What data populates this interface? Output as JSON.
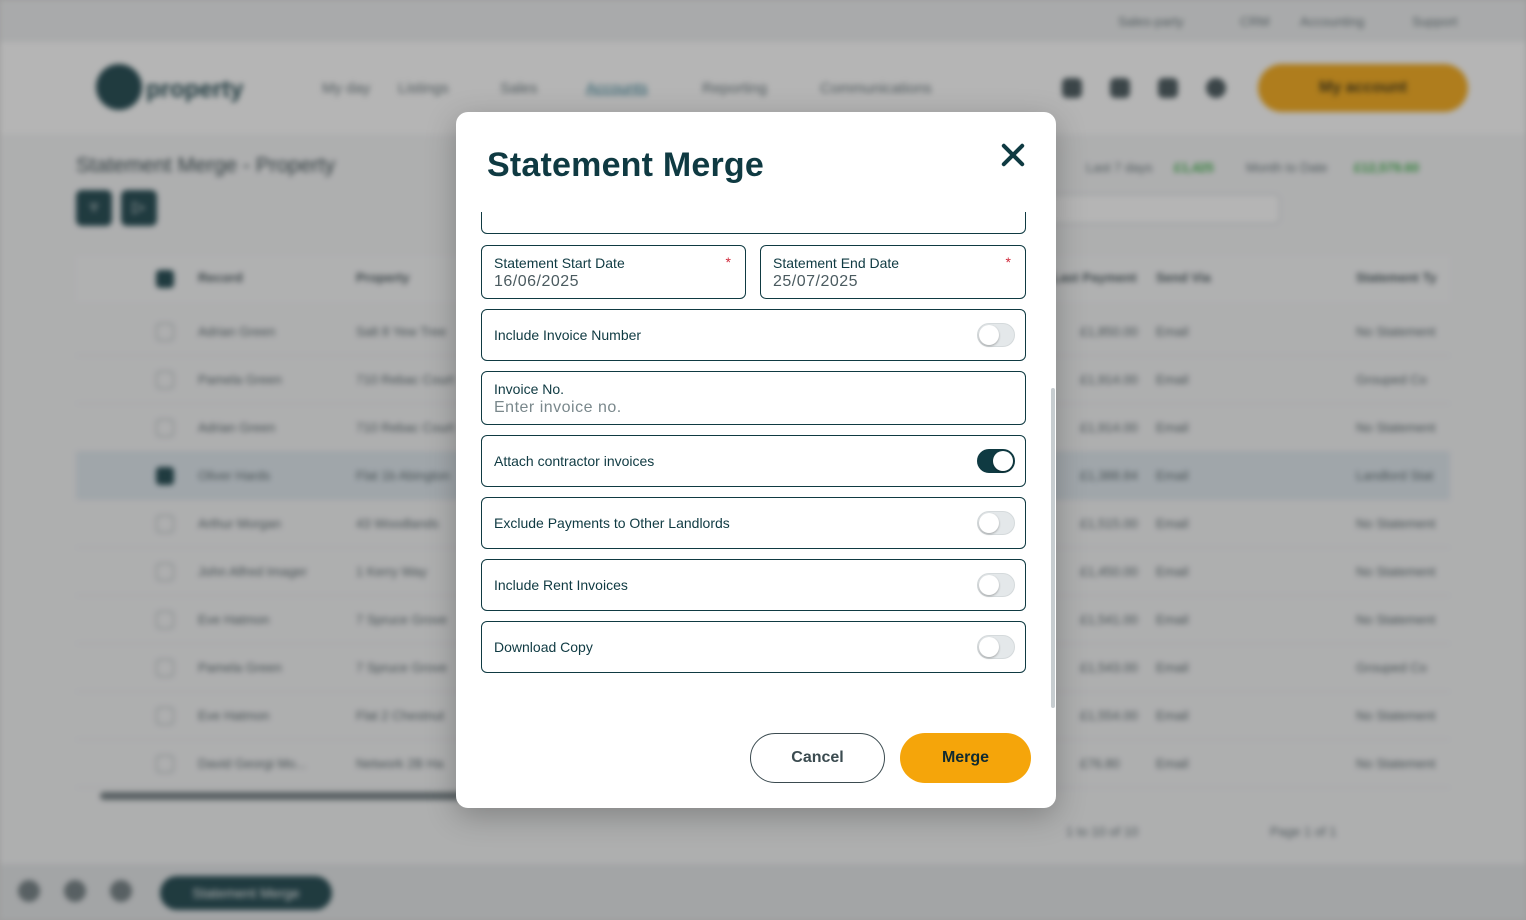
{
  "background": {
    "top_links": [
      "Sales-party",
      "CRM",
      "Accounting",
      "Support"
    ],
    "logo_text": "property",
    "nav_items": [
      "My day",
      "Listings",
      "Sales",
      "Accounts",
      "Reporting",
      "Communications"
    ],
    "active_nav": "Accounts",
    "my_account_label": "My account",
    "page_title": "Statement Merge - Property",
    "stats": [
      {
        "label": "Last 7 days",
        "value": "£1,425"
      },
      {
        "label": "Month to Date",
        "value": "£12,579.60"
      }
    ],
    "table": {
      "headers": [
        "Record",
        "Property",
        "Last Payment",
        "Send Via",
        "Statement Ty"
      ],
      "rows": [
        {
          "record": "Adrian Green",
          "property": "Salt 8 Yew Tree",
          "payment": "£1,850.00",
          "via": "Email",
          "type": "No Statement",
          "checked": false
        },
        {
          "record": "Pamela Green",
          "property": "710 Rebac Court",
          "payment": "£1,914.00",
          "via": "Email",
          "type": "Grouped Co",
          "checked": false
        },
        {
          "record": "Adrian Green",
          "property": "710 Rebac Court",
          "payment": "£1,914.00",
          "via": "Email",
          "type": "No Statement",
          "checked": false
        },
        {
          "record": "Oliver Hards",
          "property": "Flat 1b Abington",
          "payment": "£1,388.84",
          "via": "Email",
          "type": "Landlord Stat",
          "checked": true
        },
        {
          "record": "Arthur Morgan",
          "property": "43 Woodlands",
          "payment": "£1,515.00",
          "via": "Email",
          "type": "No Statement",
          "checked": false
        },
        {
          "record": "John Alfred Imager",
          "property": "1 Kerry Way",
          "payment": "£1,450.00",
          "via": "Email",
          "type": "No Statement",
          "checked": false
        },
        {
          "record": "Eve Hatmon",
          "property": "7 Spruce Grove",
          "payment": "£1,541.00",
          "via": "Email",
          "type": "No Statement",
          "checked": false
        },
        {
          "record": "Pamela Green",
          "property": "7 Spruce Grove",
          "payment": "£1,543.00",
          "via": "Email",
          "type": "Grouped Co",
          "checked": false
        },
        {
          "record": "Eve Hatmon",
          "property": "Flat 2 Chestnut",
          "payment": "£1,554.00",
          "via": "Email",
          "type": "No Statement",
          "checked": false
        },
        {
          "record": "David Georgi Mo...",
          "property": "Network 2B Ha",
          "payment": "£76.80",
          "via": "Email",
          "type": "No Statement",
          "checked": false
        }
      ]
    },
    "pager_range": "1 to 10 of 10",
    "pager_page": "Page 1 of 1",
    "bottom_pill": "Statement Merge"
  },
  "modal": {
    "title": "Statement Merge",
    "start_date": {
      "label": "Statement Start Date",
      "value": "16/06/2025",
      "required_mark": "*"
    },
    "end_date": {
      "label": "Statement End Date",
      "value": "25/07/2025",
      "required_mark": "*"
    },
    "include_invoice_number": {
      "label": "Include Invoice Number",
      "on": false
    },
    "invoice_no": {
      "label": "Invoice No.",
      "value": "",
      "placeholder": "Enter invoice no."
    },
    "attach_contractor_invoices": {
      "label": "Attach contractor invoices",
      "on": true
    },
    "exclude_payments": {
      "label": "Exclude Payments to Other Landlords",
      "on": false
    },
    "include_rent_invoices": {
      "label": "Include Rent Invoices",
      "on": false
    },
    "download_copy": {
      "label": "Download Copy",
      "on": false
    },
    "cancel_label": "Cancel",
    "merge_label": "Merge"
  },
  "colors": {
    "primary": "#0f3a42",
    "accent": "#f5a50a",
    "required": "#d0283a"
  }
}
